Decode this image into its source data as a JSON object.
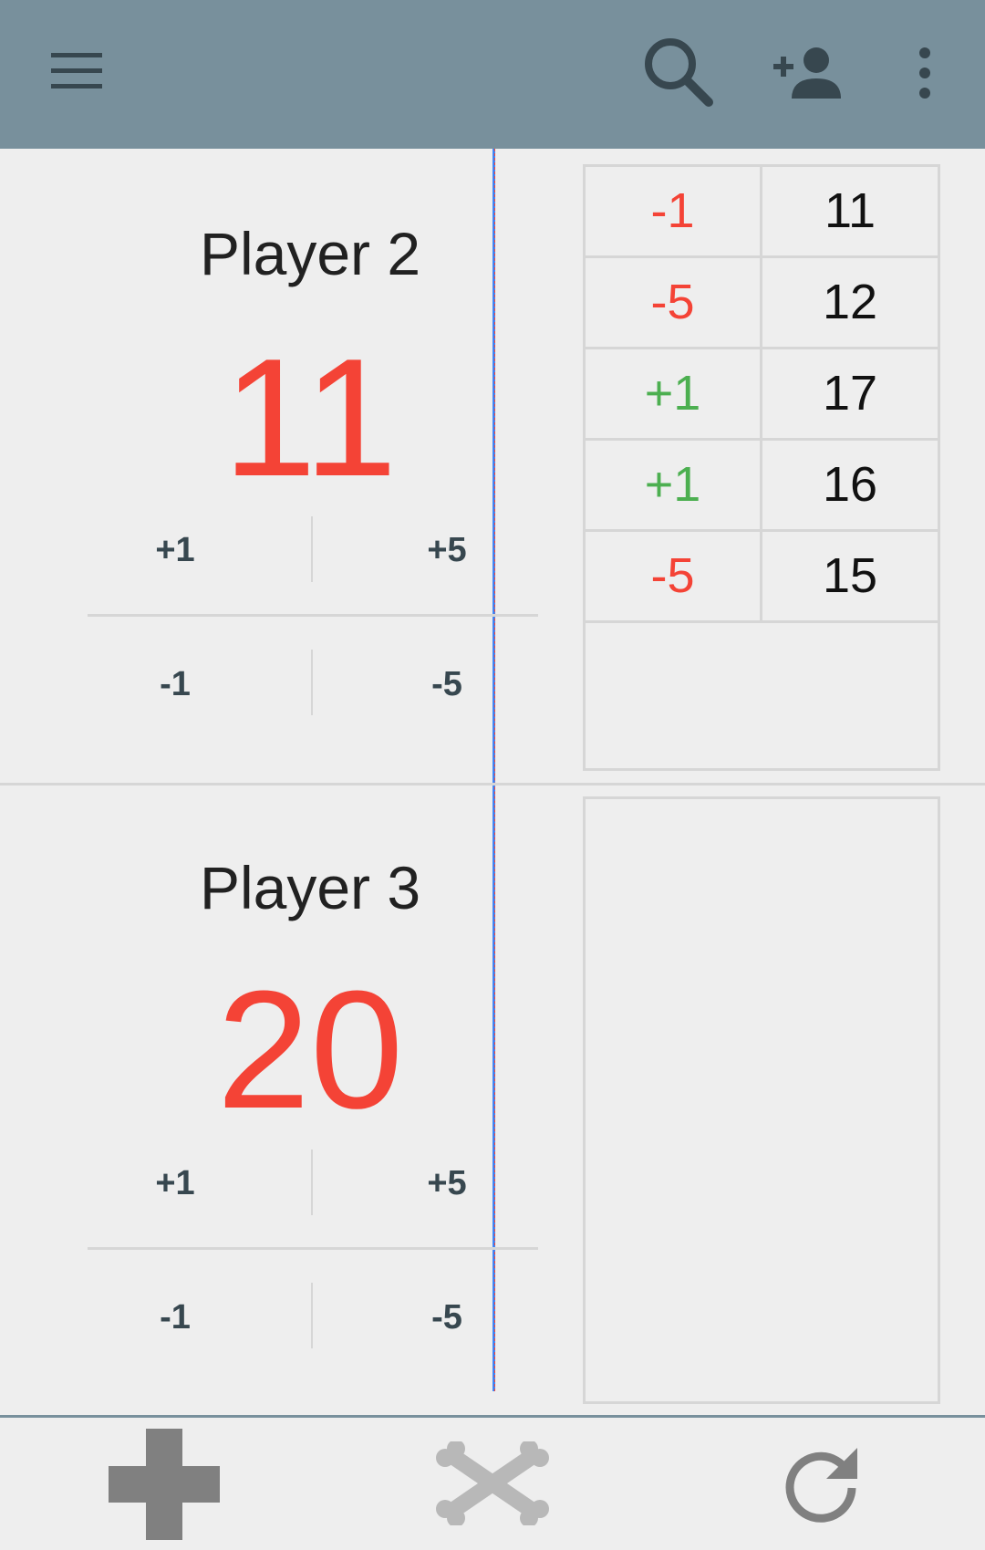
{
  "colors": {
    "appbar": "#78909c",
    "icon_dark": "#37474f",
    "negative": "#f44336",
    "positive": "#4caf50",
    "divider": "#d6d6d6",
    "bottom_icon_dark": "#808080",
    "bottom_icon_light": "#b8b8b8"
  },
  "appbar": {
    "icons": [
      "menu-icon",
      "search-icon",
      "add-person-icon",
      "more-vert-icon"
    ]
  },
  "players": [
    {
      "name": "Player 2",
      "score": "11",
      "buttons": {
        "plus_small": "+1",
        "plus_big": "+5",
        "minus_small": "-1",
        "minus_big": "-5"
      },
      "history": [
        {
          "delta": "-1",
          "total": "11",
          "sign": "negative"
        },
        {
          "delta": "-5",
          "total": "12",
          "sign": "negative"
        },
        {
          "delta": "+1",
          "total": "17",
          "sign": "positive"
        },
        {
          "delta": "+1",
          "total": "16",
          "sign": "positive"
        },
        {
          "delta": "-5",
          "total": "15",
          "sign": "negative"
        }
      ]
    },
    {
      "name": "Player 3",
      "score": "20",
      "buttons": {
        "plus_small": "+1",
        "plus_big": "+5",
        "minus_small": "-1",
        "minus_big": "-5"
      },
      "history": []
    }
  ],
  "bottom_bar": {
    "icons": [
      "add-icon",
      "crossbones-icon",
      "refresh-icon"
    ]
  }
}
